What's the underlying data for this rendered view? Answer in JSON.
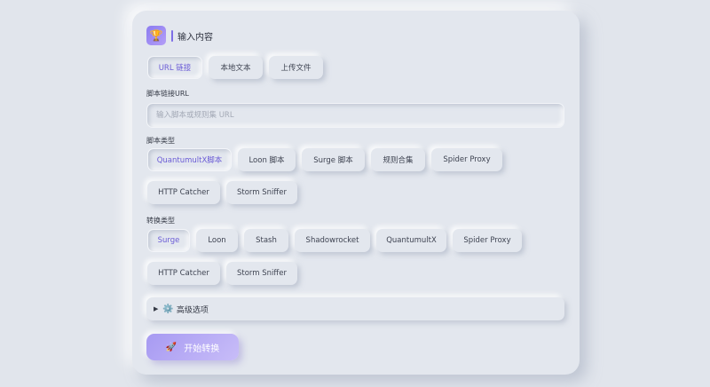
{
  "header": {
    "logo_icon": "trophy-icon",
    "logo_glyph": "🏆",
    "title": "输入内容"
  },
  "input_tabs": [
    {
      "label": "URL 链接",
      "active": true
    },
    {
      "label": "本地文本",
      "active": false
    },
    {
      "label": "上传文件",
      "active": false
    }
  ],
  "script_url": {
    "label": "脚本链接URL",
    "placeholder": "输入脚本或规则集 URL",
    "value": ""
  },
  "script_type": {
    "label": "脚本类型",
    "options": [
      "QuantumultX脚本",
      "Loon 脚本",
      "Surge 脚本",
      "规则合集",
      "Spider Proxy",
      "HTTP Catcher",
      "Storm Sniffer"
    ],
    "selected": "QuantumultX脚本"
  },
  "convert_type": {
    "label": "转换类型",
    "options": [
      "Surge",
      "Loon",
      "Stash",
      "Shadowrocket",
      "QuantumultX",
      "Spider Proxy",
      "HTTP Catcher",
      "Storm Sniffer"
    ],
    "selected": "Surge"
  },
  "advanced": {
    "toggle_glyph": "▶",
    "gear_glyph": "⚙️",
    "label": "高级选项"
  },
  "start_button": {
    "icon": "rocket-icon",
    "glyph": "🚀",
    "label": "开始转换"
  },
  "colors": {
    "accent": "#7d6ee6",
    "background": "#e1e5ec",
    "button_gradient": "#a79af2"
  }
}
